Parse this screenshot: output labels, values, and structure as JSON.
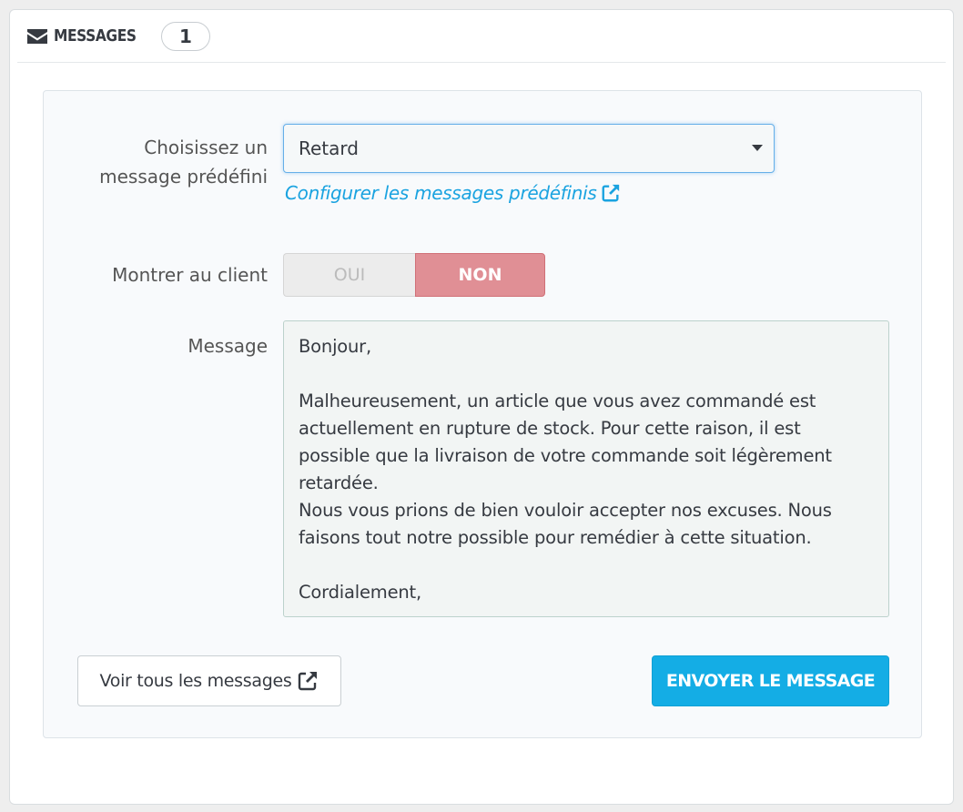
{
  "header": {
    "title": "MESSAGES",
    "count": "1",
    "icon": "envelope-icon"
  },
  "form": {
    "predefined_label_line1": "Choisissez un",
    "predefined_label_line2": "message prédéfini",
    "predefined_selected": "Retard",
    "config_link": "Configurer les messages prédéfinis",
    "show_client_label": "Montrer au client",
    "toggle_yes": "OUI",
    "toggle_no": "NON",
    "toggle_selected": "NON",
    "message_label": "Message",
    "message_lines": [
      "Bonjour,",
      "",
      "Malheureusement, un article que vous avez commandé est",
      "actuellement en rupture de stock. Pour cette raison, il est",
      "possible que la livraison de votre commande soit légèrement",
      "retardée.",
      "Nous vous prions de bien vouloir accepter nos excuses. Nous",
      "faisons tout notre possible pour remédier à cette situation.",
      "",
      "Cordialement,"
    ]
  },
  "actions": {
    "view_all": "Voir tous les messages",
    "send": "ENVOYER LE MESSAGE"
  },
  "colors": {
    "accent": "#14ade5",
    "link": "#1aa3e0",
    "toggle_no_bg": "#e08f95"
  }
}
